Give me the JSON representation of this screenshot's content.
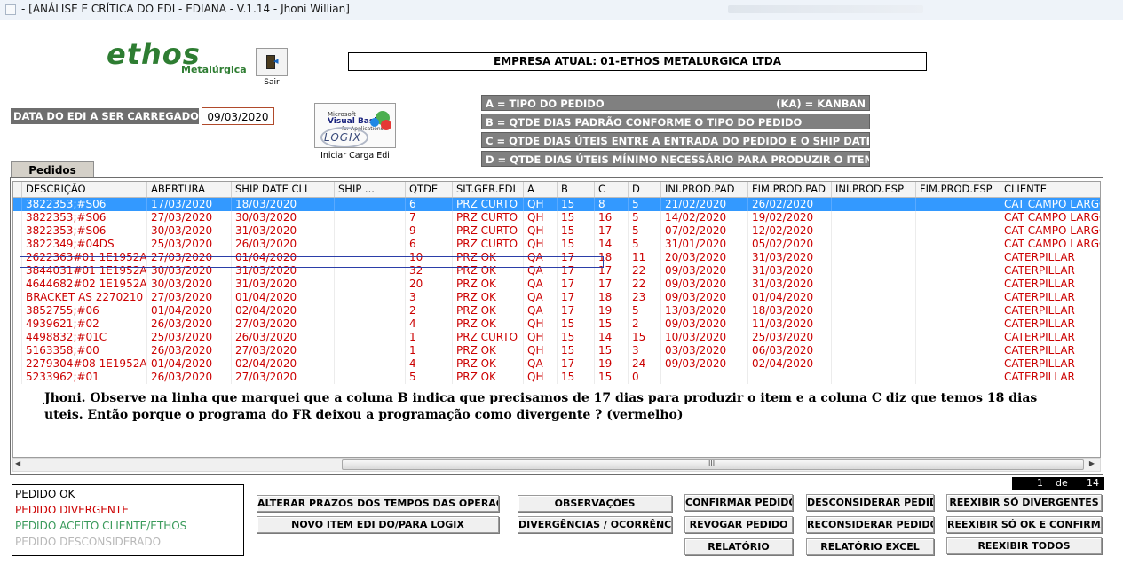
{
  "window": {
    "title": " - [ANÁLISE E CRÍTICA DO EDI - EDIANA - V.1.14 - Jhoni Willian]"
  },
  "logo": {
    "name": "ethos",
    "subtitle": "Metalúrgica"
  },
  "sair": {
    "label": "Sair"
  },
  "empresa": {
    "label": "EMPRESA ATUAL: 01-ETHOS METALURGICA LTDA"
  },
  "legend": {
    "a_left": "A = TIPO DO PEDIDO",
    "a_right": "(KA) = KANBAN",
    "b": "B = QTDE DIAS PADRÃO CONFORME O TIPO DO PEDIDO",
    "c": "C = QTDE DIAS ÚTEIS ENTRE A ENTRADA DO PEDIDO E O SHIP DATE",
    "d": "D = QTDE DIAS ÚTEIS MÍNIMO NECESSÁRIO PARA PRODUZIR O ITEM"
  },
  "edi_date": {
    "label": "DATA DO EDI A SER CARREGADO",
    "value": "09/03/2020"
  },
  "carga": {
    "label": "Iniciar Carga Edi",
    "logo_ms": "Microsoft",
    "logo_vb": "Visual Basic",
    "logo_app": "for Applications",
    "logo_logix": "LOGIX"
  },
  "tab": {
    "label": "Pedidos"
  },
  "grid": {
    "columns": [
      "DESCRIÇÃO",
      "ABERTURA",
      "SHIP DATE CLI",
      "SHIP ...",
      "QTDE",
      "SIT.GER.EDI",
      "A",
      "B",
      "C",
      "D",
      "INI.PROD.PAD",
      "FIM.PROD.PAD",
      "INI.PROD.ESP",
      "FIM.PROD.ESP",
      "CLIENTE"
    ],
    "rows": [
      [
        "3822353;#S06",
        "17/03/2020",
        "18/03/2020",
        "",
        "6",
        "PRZ CURTO",
        "QH",
        "15",
        "8",
        "5",
        "21/02/2020",
        "26/02/2020",
        "",
        "",
        "CAT CAMPO LARGO"
      ],
      [
        "3822353;#S06",
        "27/03/2020",
        "30/03/2020",
        "",
        "7",
        "PRZ CURTO",
        "QH",
        "15",
        "16",
        "5",
        "14/02/2020",
        "19/02/2020",
        "",
        "",
        "CAT CAMPO LARGO"
      ],
      [
        "3822353;#S06",
        "30/03/2020",
        "31/03/2020",
        "",
        "9",
        "PRZ CURTO",
        "QH",
        "15",
        "17",
        "5",
        "07/02/2020",
        "12/02/2020",
        "",
        "",
        "CAT CAMPO LARGO"
      ],
      [
        "3822349;#04DS",
        "25/03/2020",
        "26/03/2020",
        "",
        "6",
        "PRZ CURTO",
        "QH",
        "15",
        "14",
        "5",
        "31/01/2020",
        "05/02/2020",
        "",
        "",
        "CAT CAMPO LARGO"
      ],
      [
        "2622363#01 1E1952A",
        "27/03/2020",
        "01/04/2020",
        "",
        "10",
        "PRZ OK",
        "QA",
        "17",
        "18",
        "11",
        "20/03/2020",
        "31/03/2020",
        "",
        "",
        "CATERPILLAR"
      ],
      [
        "3844031#01 1E1952A",
        "30/03/2020",
        "31/03/2020",
        "",
        "32",
        "PRZ OK",
        "QA",
        "17",
        "17",
        "22",
        "09/03/2020",
        "31/03/2020",
        "",
        "",
        "CATERPILLAR"
      ],
      [
        "4644682#02 1E1952A",
        "30/03/2020",
        "31/03/2020",
        "",
        "20",
        "PRZ OK",
        "QA",
        "17",
        "17",
        "22",
        "09/03/2020",
        "31/03/2020",
        "",
        "",
        "CATERPILLAR"
      ],
      [
        "BRACKET AS 2270210",
        "27/03/2020",
        "01/04/2020",
        "",
        "3",
        "PRZ OK",
        "QA",
        "17",
        "18",
        "23",
        "09/03/2020",
        "01/04/2020",
        "",
        "",
        "CATERPILLAR"
      ],
      [
        "3852755;#06",
        "01/04/2020",
        "02/04/2020",
        "",
        "2",
        "PRZ OK",
        "QA",
        "17",
        "19",
        "5",
        "13/03/2020",
        "18/03/2020",
        "",
        "",
        "CATERPILLAR"
      ],
      [
        "4939621;#02",
        "26/03/2020",
        "27/03/2020",
        "",
        "4",
        "PRZ OK",
        "QH",
        "15",
        "15",
        "2",
        "09/03/2020",
        "11/03/2020",
        "",
        "",
        "CATERPILLAR"
      ],
      [
        "4498832;#01C",
        "25/03/2020",
        "26/03/2020",
        "",
        "1",
        "PRZ CURTO",
        "QH",
        "15",
        "14",
        "15",
        "10/03/2020",
        "25/03/2020",
        "",
        "",
        "CATERPILLAR"
      ],
      [
        "5163358;#00",
        "26/03/2020",
        "27/03/2020",
        "",
        "1",
        "PRZ OK",
        "QH",
        "15",
        "15",
        "3",
        "03/03/2020",
        "06/03/2020",
        "",
        "",
        "CATERPILLAR"
      ],
      [
        "2279304#08 1E1952A",
        "01/04/2020",
        "02/04/2020",
        "",
        "4",
        "PRZ OK",
        "QA",
        "17",
        "19",
        "24",
        "09/03/2020",
        "02/04/2020",
        "",
        "",
        "CATERPILLAR"
      ],
      [
        "5233962;#01",
        "26/03/2020",
        "27/03/2020",
        "",
        "5",
        "PRZ OK",
        "QH",
        "15",
        "15",
        "0",
        "",
        "",
        "",
        "",
        "CATERPILLAR"
      ]
    ],
    "selected_row": 0,
    "marked_row": 4
  },
  "note": {
    "text": "Jhoni. Observe na linha que marquei que a coluna B indica que precisamos de 17 dias para produzir o item e a coluna C diz que temos 18 dias uteis. Então porque o programa do FR deixou a programação como divergente ? (vermelho)"
  },
  "scroll": {
    "grip": "III"
  },
  "pager": {
    "current": "1",
    "sep": "de",
    "total": "14"
  },
  "status_legend": {
    "ok": "PEDIDO OK",
    "divergente": "PEDIDO  DIVERGENTE",
    "aceito": "PEDIDO ACEITO CLIENTE/ETHOS",
    "desconsiderado": "PEDIDO DESCONSIDERADO"
  },
  "colors": {
    "ok": "#000000",
    "divergente": "#cc0000",
    "aceito": "#3a9a5b",
    "desconsiderado": "#b8b8b8",
    "selection": "#3399ff",
    "legend_bg": "#808080"
  },
  "buttons": {
    "alterar_prazos": "ALTERAR PRAZOS DOS TEMPOS DAS OPERAÇÕES",
    "novo_item": "NOVO ITEM EDI DO/PARA LOGIX",
    "observacoes": "OBSERVAÇÕES",
    "divergencias": "DIVERGÊNCIAS / OCORRÊNCIAS",
    "confirmar": "CONFIRMAR PEDIDO",
    "revogar": "REVOGAR PEDIDO",
    "relatorio": "RELATÓRIO",
    "desconsiderar": "DESCONSIDERAR  PEDIDO",
    "reconsiderar": "RECONSIDERAR PEDIDO",
    "relatorio_excel": "RELATÓRIO EXCEL",
    "reexibir_divergentes": "REEXIBIR SÓ DIVERGENTES",
    "reexibir_ok": "REEXIBIR SÓ OK E CONFIRMADO",
    "reexibir_todos": "REEXIBIR TODOS"
  }
}
